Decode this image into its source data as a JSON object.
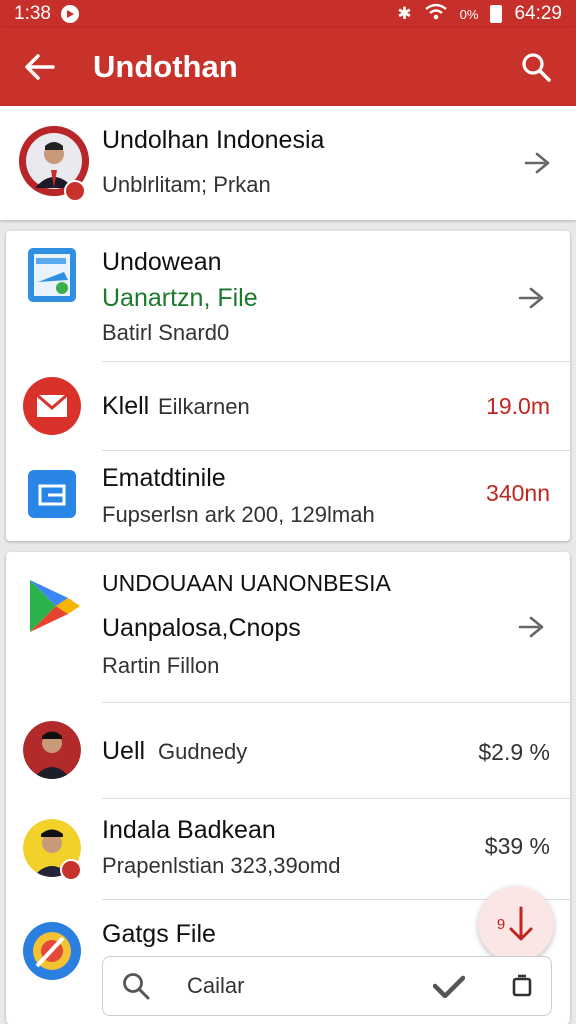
{
  "status": {
    "time": "1:38",
    "right_text": "64:29",
    "sig_text": "0%"
  },
  "appbar": {
    "title": "Undothan",
    "back_icon": "arrow-left-icon",
    "search_icon": "search-icon"
  },
  "header_item": {
    "title": "Undolhan Indonesia",
    "subtitle": "Unblrlitam; Prkan"
  },
  "card1": {
    "item1": {
      "title": "Undowean",
      "line2": "Uanartzn, File",
      "line3": "Batirl Snard0"
    },
    "item2": {
      "title": "Klell",
      "subtitle": "Eilkarnen",
      "value": "19.0m"
    },
    "item3": {
      "title": "Ematdtinile",
      "subtitle": "Fupserlsn ark 200, 129lmah",
      "value": "340nn"
    }
  },
  "card2": {
    "item1": {
      "title": "UNDOUAAN UANONBESIA",
      "line2": "Uanpalosa,Cnops",
      "line3": "Rartin Fillon"
    },
    "item2": {
      "title": "Uell",
      "subtitle": "Gudnedy",
      "value": "$2.9 %"
    },
    "item3": {
      "title": "Indala Badkean",
      "subtitle": "Prapenlstian 323,39omd",
      "value": "$39 %"
    },
    "item4": {
      "title": "Gatgs File"
    }
  },
  "fab": {
    "label": "9"
  },
  "bottombar": {
    "placeholder": "Cailar"
  },
  "colors": {
    "primary": "#c8322b",
    "accent_red": "#c0261f",
    "green": "#1a7a2a"
  }
}
